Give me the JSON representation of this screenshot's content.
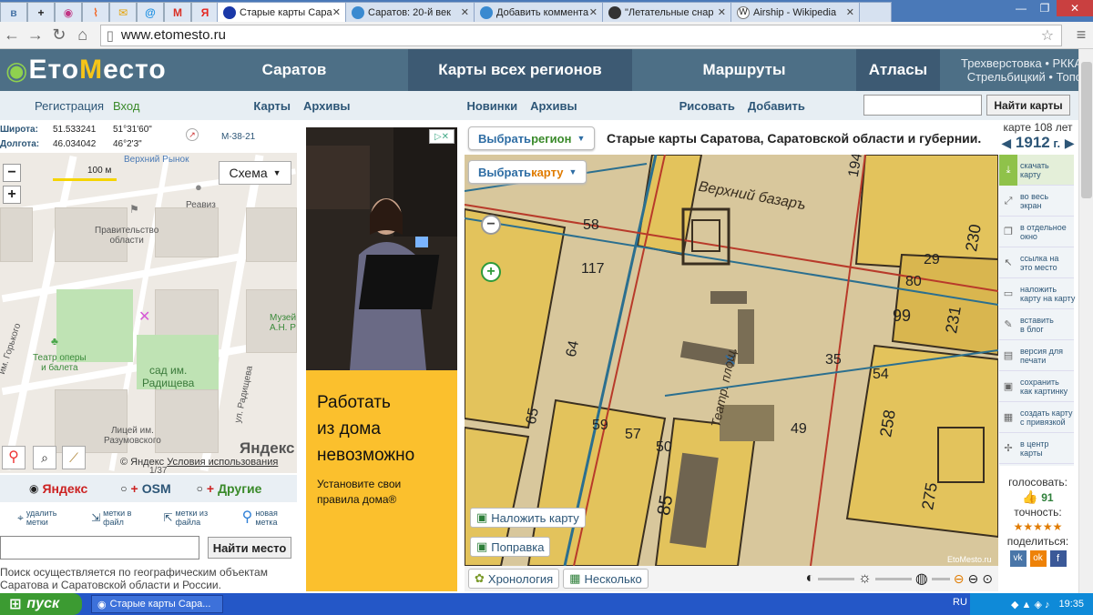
{
  "browser": {
    "tabs": [
      {
        "label": "Старые карты Сара",
        "active": true,
        "color": "#1a38a8"
      },
      {
        "label": "Саратов: 20-й век",
        "active": false,
        "color": "#3a8ad0"
      },
      {
        "label": "Добавить коммента",
        "active": false,
        "color": "#3a8ad0"
      },
      {
        "label": "\"Летательные снар",
        "active": false,
        "color": "#333333"
      },
      {
        "label": "Airship - Wikipedia",
        "active": false,
        "color": "#777777"
      }
    ],
    "pinned_icons": [
      "vk-icon",
      "plus-icon",
      "instagram-icon",
      "rss-icon",
      "mail-icon",
      "mail-ru-icon",
      "gmail-icon",
      "yandex-icon"
    ],
    "url": "www.etomesto.ru"
  },
  "site": {
    "logo_left": "Ето",
    "logo_mid": "М",
    "logo_right": "есто",
    "nav": [
      "Саратов",
      "Карты всех регионов",
      "Маршруты",
      "Атласы"
    ],
    "right_line1": "Трехверстовка • РККА",
    "right_line2": "Стрельбицкий • Топо",
    "subnav": {
      "register": "Регистрация",
      "login": "Вход",
      "maps": "Карты",
      "archives": "Архивы",
      "news": "Новинки",
      "archives2": "Архивы",
      "draw": "Рисовать",
      "add": "Добавить"
    },
    "search_button": "Найти карты"
  },
  "left": {
    "lat_label": "Широта:",
    "lat_dec": "51.533241",
    "lat_dms": "51°31'60\"",
    "lon_label": "Долгота:",
    "lon_dec": "46.034042",
    "lon_dms": "46°2'3\"",
    "sheet": "М-38-21",
    "scale": "100 м",
    "schema": "Схема",
    "map_labels": {
      "market": "Верхний Рынок",
      "gov": "Правительство\nобласти",
      "reaviz": "Реавиз",
      "theater": "Театр оперы\nи балета",
      "park": "сад им.\nРадищева",
      "museum": "Музей\nА.Н. Р",
      "lyceum": "Лицей им.\nРазумовского",
      "gorky": "им. Горького",
      "radish": "ул. Радищева",
      "num": "1/37"
    },
    "yandex_logo": "Яндекс",
    "copyright": "© Яндекс",
    "terms": "Условия использования",
    "providers": [
      "Яндекс",
      "OSM",
      "Другие"
    ],
    "tools": [
      "удалить\nметки",
      "метки в\nфайл",
      "метки из\nфайла",
      "новая\nметка"
    ],
    "find_place": "Найти место",
    "hint": "Поиск осуществляется по географическим объектам Саратова и Саратовской области и России."
  },
  "ad": {
    "title": "Работать\nиз дома\nневозможно",
    "subtitle": "Установите свои\nправила дома",
    "registered": "®"
  },
  "main": {
    "select_region": "Выбрать ",
    "region_word": "регион",
    "select_map": "Выбрать ",
    "map_word": "карту",
    "title": "Старые карты Саратова, Саратовской области и губернии.",
    "overlay": "Наложить карту",
    "fix": "Поправка",
    "chronology": "Хронология",
    "several": "Несколько",
    "watermark": "EtoMesto.ru",
    "map_texts": [
      "Верхний базаръ",
      "Театр. площ.",
      "58",
      "117",
      "64",
      "65",
      "59",
      "57",
      "50",
      "85",
      "49",
      "35",
      "80",
      "99",
      "231",
      "54",
      "258",
      "275",
      "194",
      "230",
      "29"
    ]
  },
  "right": {
    "age_label": "карте 108 лет",
    "year": "1912",
    "year_suffix": " г.",
    "menu": [
      {
        "label": "скачать\nкарту",
        "icon": "download-icon"
      },
      {
        "label": "во весь\nэкран",
        "icon": "fullscreen-icon"
      },
      {
        "label": "в отдельное\nокно",
        "icon": "window-icon"
      },
      {
        "label": "ссылка на\nэто место",
        "icon": "link-icon"
      },
      {
        "label": "наложить\nкарту на карту",
        "icon": "layers-icon"
      },
      {
        "label": "вставить\nв блог",
        "icon": "embed-icon"
      },
      {
        "label": "версия для\nпечати",
        "icon": "print-icon"
      },
      {
        "label": "сохранить\nкак картинку",
        "icon": "save-icon"
      },
      {
        "label": "создать карту\nс привязкой",
        "icon": "grid-icon"
      },
      {
        "label": "в центр\nкарты",
        "icon": "center-icon"
      }
    ],
    "vote_label": "голосовать:",
    "votes": "91",
    "accuracy_label": "точность:",
    "stars": "★★★★★",
    "share_label": "поделиться:"
  },
  "taskbar": {
    "start": "пуск",
    "item": "Старые карты Сара...",
    "lang": "RU",
    "time": "19:35"
  },
  "colors": {
    "header_dark": "#3d5a73",
    "header_light": "#4d6f86",
    "link": "#2d5677",
    "accent_orange": "#e07b00",
    "ad_yellow": "#fbc02d",
    "map_paper": "#d8c79c",
    "block_yellow": "#e8c45a"
  }
}
